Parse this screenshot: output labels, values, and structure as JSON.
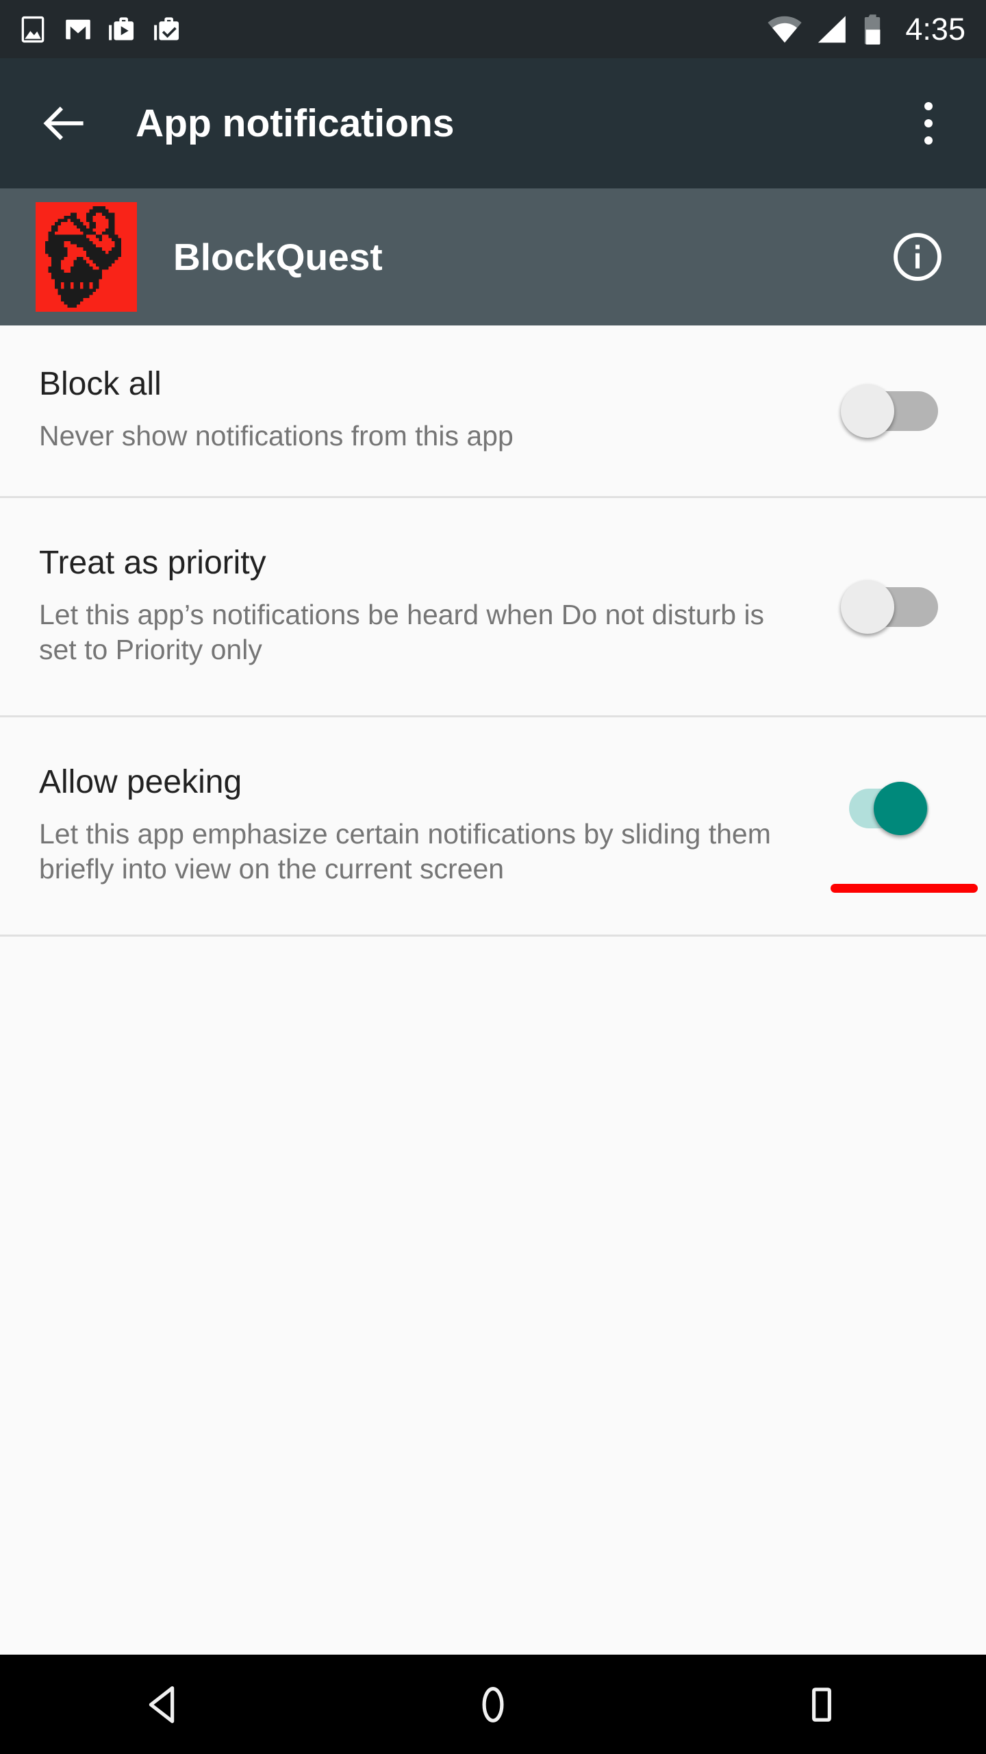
{
  "status_bar": {
    "icons": [
      "screenshot-image-icon",
      "gmail-icon",
      "work-play-store-icon",
      "work-checkmark-icon"
    ],
    "wifi": "wifi-partial-icon",
    "signal": "cellular-signal-icon",
    "battery": "battery-half-icon",
    "time": "4:35",
    "background_color": "#23292d"
  },
  "action_bar": {
    "back_icon": "arrow-back-icon",
    "title": "App notifications",
    "overflow_icon": "more-vert-icon",
    "background_color": "#263238"
  },
  "app_header": {
    "app_icon": "blockquest-skull-icon",
    "app_name": "BlockQuest",
    "info_icon": "info-outline-icon",
    "background_color": "#4e5b61",
    "icon_background_color": "#f92318"
  },
  "settings": [
    {
      "title": "Block all",
      "summary": "Never show notifications from this app",
      "switch_state": "off",
      "switch_name": "block-all-switch"
    },
    {
      "title": "Treat as priority",
      "summary": "Let this app’s notifications be heard when Do not disturb is set to Priority only",
      "switch_state": "off",
      "switch_name": "treat-as-priority-switch"
    },
    {
      "title": "Allow peeking",
      "summary": "Let this app emphasize certain notifications by sliding them briefly into view on the current screen",
      "switch_state": "on",
      "switch_name": "allow-peeking-switch"
    }
  ],
  "annotation": {
    "color": "#fe0000",
    "target": "allow-peeking-switch"
  },
  "nav_bar": {
    "back_icon": "nav-back-triangle-icon",
    "home_icon": "nav-home-circle-icon",
    "recents_icon": "nav-recents-square-icon",
    "background_color": "#000000"
  },
  "colors": {
    "accent_on": "#00897b",
    "track_on": "#b2dfdb",
    "track_off": "#b4b4b4",
    "thumb_off": "#ececec",
    "page_background": "#fafafa",
    "divider": "#e0e0e0",
    "title_text": "#212121",
    "summary_text": "#757575"
  }
}
